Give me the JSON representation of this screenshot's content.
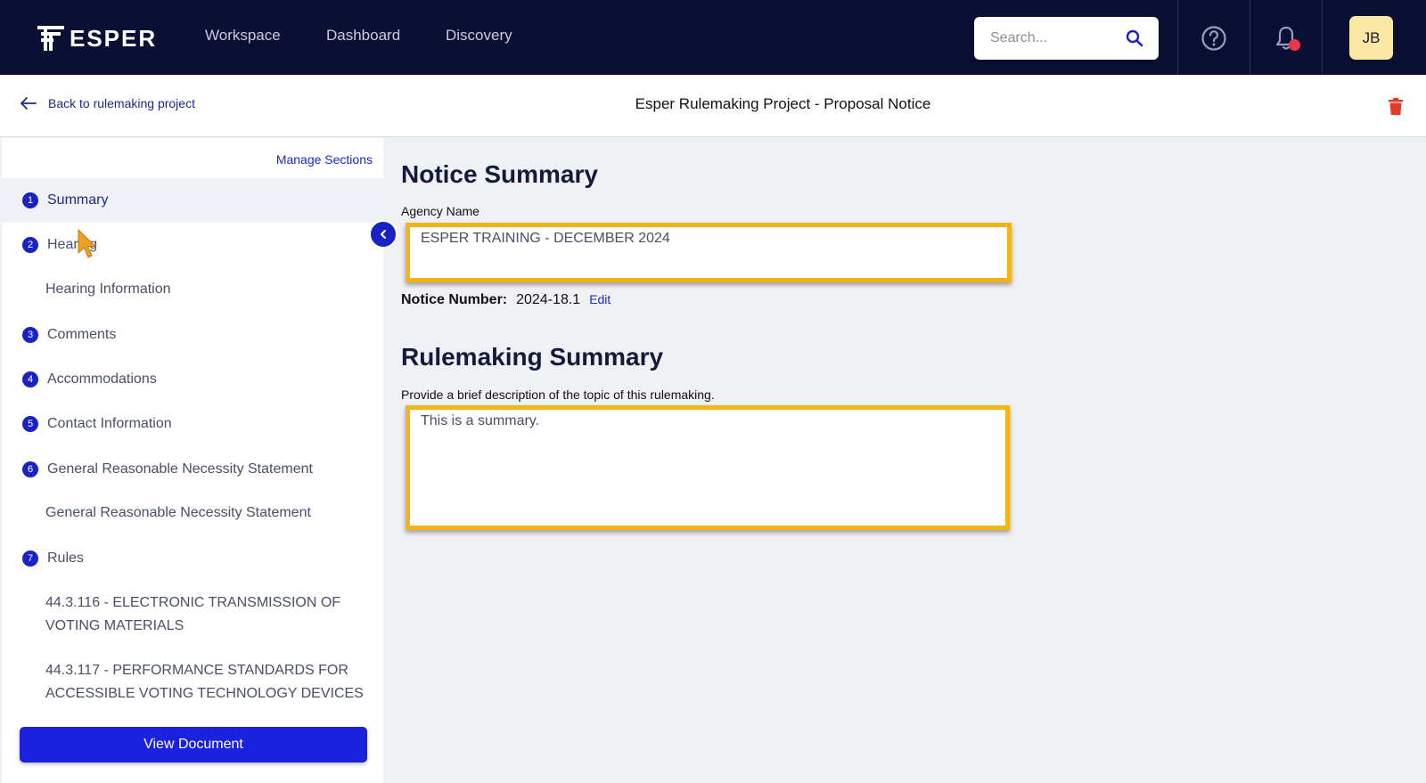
{
  "app": {
    "logo_text": "ESPER"
  },
  "nav": {
    "items": [
      "Workspace",
      "Dashboard",
      "Discovery"
    ]
  },
  "search": {
    "placeholder": "Search..."
  },
  "user": {
    "initials": "JB"
  },
  "header": {
    "back_label": "Back to rulemaking project",
    "title": "Esper Rulemaking Project - Proposal Notice"
  },
  "sidebar": {
    "manage_label": "Manage Sections",
    "items": [
      {
        "num": "1",
        "label": "Summary"
      },
      {
        "num": "2",
        "label": "Hearing"
      },
      {
        "num": "3",
        "label": "Comments"
      },
      {
        "num": "4",
        "label": "Accommodations"
      },
      {
        "num": "5",
        "label": "Contact Information"
      },
      {
        "num": "6",
        "label": "General Reasonable Necessity Statement"
      },
      {
        "num": "7",
        "label": "Rules"
      }
    ],
    "subitems": [
      "Hearing Information",
      "General Reasonable Necessity Statement",
      "44.3.116 - ELECTRONIC TRANSMISSION OF VOTING MATERIALS",
      "44.3.117 - PERFORMANCE STANDARDS FOR ACCESSIBLE VOTING TECHNOLOGY DEVICES"
    ],
    "view_document_label": "View Document"
  },
  "notice_summary": {
    "heading": "Notice Summary",
    "agency_label": "Agency Name",
    "agency_value": "ESPER TRAINING - DECEMBER 2024",
    "notice_number_label": "Notice Number:",
    "notice_number_value": "2024-18.1",
    "edit_label": "Edit"
  },
  "rulemaking_summary": {
    "heading": "Rulemaking Summary",
    "description_label": "Provide a brief description of the topic of this rulemaking.",
    "value": "This is a summary."
  },
  "colors": {
    "nav_bg": "#0b0f33",
    "accent": "#1a22c4",
    "highlight": "#f2b417",
    "notification": "#e8384f"
  }
}
